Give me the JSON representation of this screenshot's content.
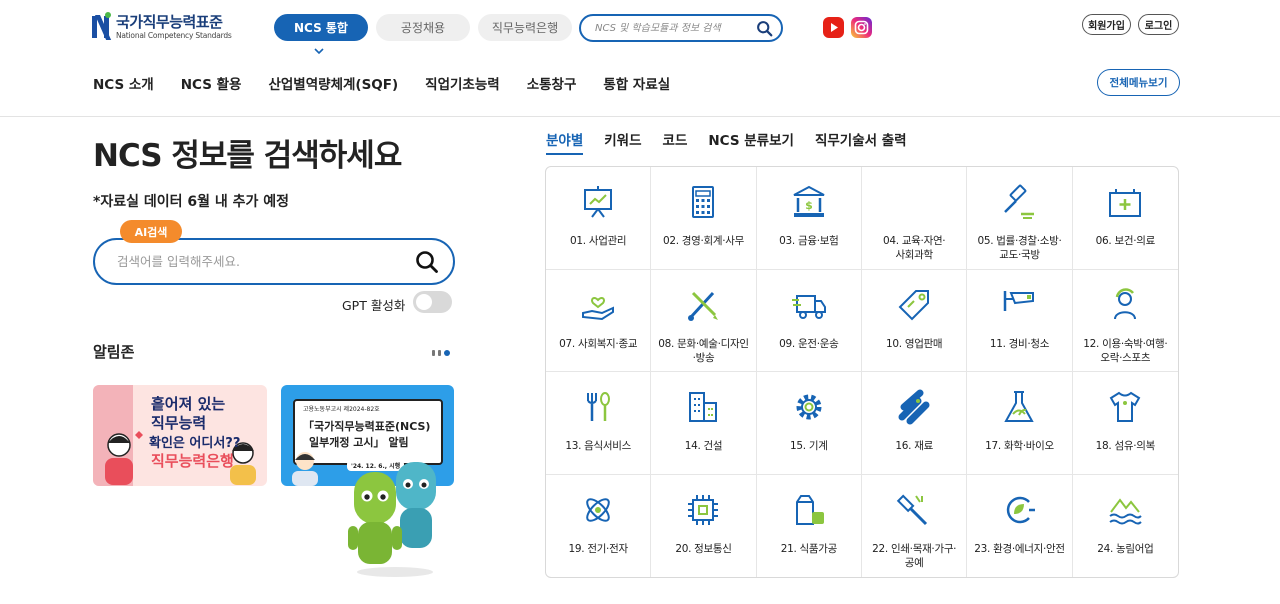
{
  "header": {
    "logo_ko": "국가직무능력표준",
    "logo_en": "National Competency Standards",
    "tabs": [
      {
        "label": "NCS 통합"
      },
      {
        "label": "공정채용"
      },
      {
        "label": "직무능력은행"
      }
    ],
    "search_placeholder": "NCS 및 학습모듈과 정보 검색",
    "login_signup": "회원가입",
    "login": "로그인",
    "gnb": [
      "NCS 소개",
      "NCS 활용",
      "산업별역량체계(SQF)",
      "직업기초능력",
      "소통창구",
      "통합 자료실"
    ],
    "all_menu": "전체메뉴보기"
  },
  "left": {
    "title": "NCS 정보를 검색하세요",
    "notice": "*자료실 데이터 6월 내 추가 예정",
    "ai_badge": "AI검색",
    "search_placeholder": "검색어를 입력해주세요.",
    "gpt_label": "GPT 활성화",
    "gpt_enabled": false,
    "notice_zone": "알림존",
    "banner1": {
      "line1": "흩어져 있는",
      "line2": "직무능력",
      "line3": "확인은 어디서??",
      "line4": "직무능력은행"
    },
    "banner2": {
      "tag": "고용노동부고시 제2024-82호",
      "line1": "「국가직무능력표준(NCS)",
      "line2": "일부개정 고시」 알림",
      "date": "'24. 12. 6., 시행"
    }
  },
  "right": {
    "tabs": [
      "분야별",
      "키워드",
      "코드",
      "NCS 분류보기",
      "직무기술서 출력"
    ],
    "categories": [
      {
        "label": "01. 사업관리",
        "icon": "presentation-board-icon"
      },
      {
        "label": "02. 경영·회계·사무",
        "icon": "calculator-icon"
      },
      {
        "label": "03. 금융·보험",
        "icon": "bank-icon"
      },
      {
        "label": "04. 교육·자연·\n사회과학",
        "icon": "blank"
      },
      {
        "label": "05. 법률·경찰·소방·\n교도·국방",
        "icon": "gavel-icon"
      },
      {
        "label": "06. 보건·의료",
        "icon": "first-aid-kit-icon"
      },
      {
        "label": "07. 사회복지·종교",
        "icon": "hand-heart-icon"
      },
      {
        "label": "08. 문화·예술·디자인\n·방송",
        "icon": "brush-pencil-icon"
      },
      {
        "label": "09. 운전·운송",
        "icon": "truck-icon"
      },
      {
        "label": "10. 영업판매",
        "icon": "price-tag-icon"
      },
      {
        "label": "11. 경비·청소",
        "icon": "cctv-icon"
      },
      {
        "label": "12. 이용·숙박·여행·\n오락·스포츠",
        "icon": "person-icon"
      },
      {
        "label": "13. 음식서비스",
        "icon": "fork-spoon-icon"
      },
      {
        "label": "14. 건설",
        "icon": "building-icon"
      },
      {
        "label": "15. 기계",
        "icon": "gear-icon"
      },
      {
        "label": "16. 재료",
        "icon": "pipes-icon"
      },
      {
        "label": "17. 화학·바이오",
        "icon": "flask-icon"
      },
      {
        "label": "18. 섬유·의복",
        "icon": "shirt-icon"
      },
      {
        "label": "19. 전기·전자",
        "icon": "atom-icon"
      },
      {
        "label": "20. 정보통신",
        "icon": "chip-icon"
      },
      {
        "label": "21. 식품가공",
        "icon": "food-package-icon"
      },
      {
        "label": "22. 인쇄·목재·가구·\n공예",
        "icon": "hammer-icon"
      },
      {
        "label": "23. 환경·에너지·안전",
        "icon": "eco-plug-icon"
      },
      {
        "label": "24. 농림어업",
        "icon": "mountain-water-icon"
      }
    ]
  },
  "colors": {
    "primary": "#1764b4",
    "accent_green": "#8cc63f",
    "ai_orange": "#f48b2c"
  }
}
